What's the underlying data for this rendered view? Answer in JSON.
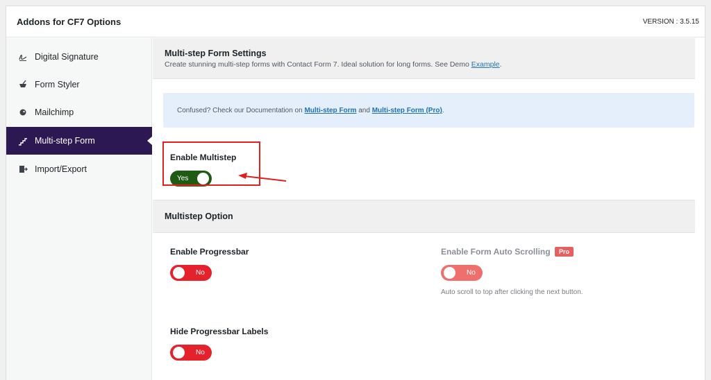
{
  "header": {
    "title": "Addons for CF7 Options",
    "version": "VERSION : 3.5.15"
  },
  "sidebar": {
    "items": [
      {
        "label": "Digital Signature",
        "icon": "signature-icon"
      },
      {
        "label": "Form Styler",
        "icon": "brush-icon"
      },
      {
        "label": "Mailchimp",
        "icon": "mailchimp-icon"
      },
      {
        "label": "Multi-step Form",
        "icon": "steps-icon",
        "active": true
      },
      {
        "label": "Import/Export",
        "icon": "import-export-icon"
      }
    ]
  },
  "settings": {
    "title": "Multi-step Form Settings",
    "desc_prefix": "Create stunning multi-step forms with Contact Form 7. Ideal solution for long forms. See Demo ",
    "desc_link": "Example",
    "desc_suffix": "."
  },
  "notice": {
    "prefix": "Confused? Check our Documentation on ",
    "link1": "Multi-step Form",
    "middle": " and ",
    "link2": "Multi-step Form (Pro)",
    "suffix": "."
  },
  "enable_multistep": {
    "label": "Enable Multistep",
    "value": "Yes"
  },
  "multistep_option": {
    "title": "Multistep Option"
  },
  "enable_progressbar": {
    "label": "Enable Progressbar",
    "value": "No"
  },
  "auto_scrolling": {
    "label": "Enable Form Auto Scrolling",
    "badge": "Pro",
    "value": "No",
    "help": "Auto scroll to top after clicking the next button."
  },
  "hide_progressbar_labels": {
    "label": "Hide Progressbar Labels",
    "value": "No"
  },
  "colors": {
    "sidebar_active": "#2c1852",
    "toggle_on": "#1f5b12",
    "toggle_off": "#e5222b",
    "annotation": "#e0201c",
    "link": "#2271b1"
  }
}
